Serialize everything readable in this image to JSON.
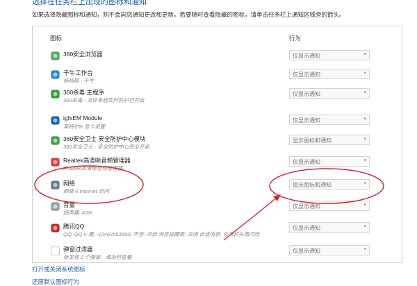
{
  "header": {
    "heading": "选择在任务栏上出现的图标和通知",
    "intro": "如果选择隐藏图标和通知，则不会向您通知更改和更新。若要随时查看隐藏的图标，请单击任务栏上通知区域旁的箭头。"
  },
  "table": {
    "col_icons": "图标",
    "col_behavior": "行为",
    "rows": [
      {
        "name": "360安全浏览器",
        "desc": "",
        "value": "仅显示通知",
        "icon": "browser-360-icon",
        "color": "#4caf50"
      },
      {
        "name": "千牛工作台",
        "desc": "杨杨舆 - 千牛",
        "value": "仅显示通知",
        "icon": "qianniu-icon",
        "color": "#1e88e5"
      },
      {
        "name": "360杀毒 主程序",
        "desc": "360杀毒 - 文件系统实时防护已开启",
        "value": "仅显示通知",
        "icon": "shield-icon",
        "color": "#2e9e3e"
      },
      {
        "name": "igfxEM Module",
        "desc": "英特尔® 显卡设置",
        "value": "仅显示通知",
        "icon": "intel-graphics-icon",
        "color": "#1565c0"
      },
      {
        "name": "360安全卫士 安全防护中心模块",
        "desc": "360安全卫士 - 安全防护中心完全开启",
        "value": "显示图标和通知",
        "icon": "safeguard-360-icon",
        "color": "#43a047"
      },
      {
        "name": "Realtek高清晰音频管理器",
        "desc": "Realtek高清晰音频管理器",
        "value": "仅显示通知",
        "icon": "speaker-icon",
        "color": "#e53935"
      },
      {
        "name": "网络",
        "desc": "网络 6 Internet 访问",
        "value": "显示图标和通知",
        "icon": "network-icon",
        "color": "#607d8b"
      },
      {
        "name": "音量",
        "desc": "扬声器: 40%",
        "value": "仅显示通知",
        "icon": "volume-icon",
        "color": "#90a4ae"
      },
      {
        "name": "腾讯QQ",
        "desc": "QQ: QQ n 潮, ~(2463553959) 声音: 开启 消息提醒框: 关闭 会话消息: 任务栏头像闪烁",
        "value": "仅显示通知",
        "icon": "qq-icon",
        "color": "#c62828"
      },
      {
        "name": "弹窗过滤器",
        "desc": "新发现 1 个弹窗，请及时查看",
        "value": "仅显示通知",
        "icon": "popup-filter-icon",
        "color": "#ffffff"
      }
    ]
  },
  "links": {
    "system_icons": "打开或关闭系统图标",
    "restore": "还原默认图标行为"
  },
  "colors": {
    "annotation": "#d9262a",
    "link": "#1e5aa8"
  }
}
